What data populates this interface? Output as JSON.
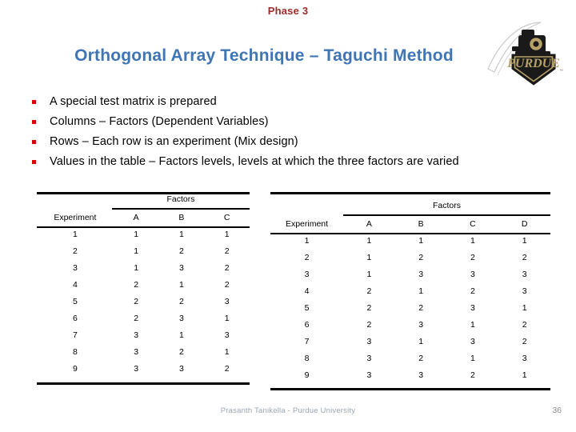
{
  "slide": {
    "phase_label": "Phase 3",
    "title": "Orthogonal Array Technique – Taguchi Method",
    "title_color": "#3f75b5",
    "phase_color": "#9e2a2a",
    "bullet_color": "#d40000",
    "background": "#ffffff"
  },
  "logo": {
    "name": "purdue-boilermaker-logo",
    "wordmark": "PURDUE",
    "gold": "#b9a26a",
    "black": "#111111"
  },
  "bullets": [
    {
      "text": "A special test matrix is prepared"
    },
    {
      "text": "Columns – Factors (Dependent Variables)"
    },
    {
      "text": "Rows – Each row is an experiment (Mix design)"
    },
    {
      "text": "Values in the table – Factors levels, levels at which the three factors are varied"
    }
  ],
  "tables": {
    "left": {
      "group_header": "Factors",
      "experiment_header": "Experiment",
      "factor_headers": [
        "A",
        "B",
        "C"
      ],
      "rows": [
        {
          "experiment": "1",
          "values": [
            "1",
            "1",
            "1"
          ]
        },
        {
          "experiment": "2",
          "values": [
            "1",
            "2",
            "2"
          ]
        },
        {
          "experiment": "3",
          "values": [
            "1",
            "3",
            "2"
          ]
        },
        {
          "experiment": "4",
          "values": [
            "2",
            "1",
            "2"
          ]
        },
        {
          "experiment": "5",
          "values": [
            "2",
            "2",
            "3"
          ]
        },
        {
          "experiment": "6",
          "values": [
            "2",
            "3",
            "1"
          ]
        },
        {
          "experiment": "7",
          "values": [
            "3",
            "1",
            "3"
          ]
        },
        {
          "experiment": "8",
          "values": [
            "3",
            "2",
            "1"
          ]
        },
        {
          "experiment": "9",
          "values": [
            "3",
            "3",
            "2"
          ]
        }
      ]
    },
    "right": {
      "group_header": "Factors",
      "experiment_header": "Experiment",
      "factor_headers": [
        "A",
        "B",
        "C",
        "D"
      ],
      "rows": [
        {
          "experiment": "1",
          "values": [
            "1",
            "1",
            "1",
            "1"
          ]
        },
        {
          "experiment": "2",
          "values": [
            "1",
            "2",
            "2",
            "2"
          ]
        },
        {
          "experiment": "3",
          "values": [
            "1",
            "3",
            "3",
            "3"
          ]
        },
        {
          "experiment": "4",
          "values": [
            "2",
            "1",
            "2",
            "3"
          ]
        },
        {
          "experiment": "5",
          "values": [
            "2",
            "2",
            "3",
            "1"
          ]
        },
        {
          "experiment": "6",
          "values": [
            "2",
            "3",
            "1",
            "2"
          ]
        },
        {
          "experiment": "7",
          "values": [
            "3",
            "1",
            "3",
            "2"
          ]
        },
        {
          "experiment": "8",
          "values": [
            "3",
            "2",
            "1",
            "3"
          ]
        },
        {
          "experiment": "9",
          "values": [
            "3",
            "3",
            "2",
            "1"
          ]
        }
      ]
    }
  },
  "footer": {
    "note": "Prasanth Tanikella - Purdue University",
    "page_number": "36"
  }
}
